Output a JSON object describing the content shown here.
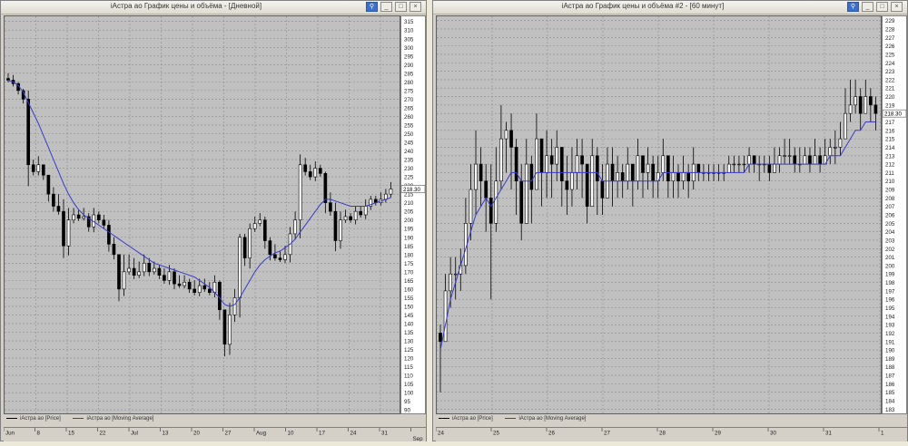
{
  "windows": [
    {
      "title": "iАстра ао График цены и объёма - [Дневной]",
      "buttons": [
        "⚲",
        "_",
        "□",
        "×"
      ],
      "legend": {
        "price": "iАстра ао [Price]",
        "ma": "iАстра ао [Moving Average]"
      },
      "current_price_label": "218.30",
      "x_tick_labels": [
        "Jun",
        "8",
        "15",
        "22",
        "Jul",
        "13",
        "20",
        "27",
        "Aug",
        "10",
        "17",
        "24",
        "31",
        "Sep"
      ],
      "y_tick_labels": [
        "315",
        "310",
        "305",
        "300",
        "295",
        "290",
        "285",
        "280",
        "275",
        "270",
        "265",
        "260",
        "255",
        "250",
        "245",
        "240",
        "235",
        "230",
        "225",
        "220",
        "215",
        "210",
        "205",
        "200",
        "195",
        "190",
        "185",
        "180",
        "175",
        "170",
        "165",
        "160",
        "155",
        "150",
        "145",
        "140",
        "135",
        "130",
        "125",
        "120",
        "115",
        "110",
        "105",
        "100",
        "95",
        "90"
      ]
    },
    {
      "title": "iАстра ао График цены и объёма #2 - [60 минут]",
      "buttons": [
        "⚲",
        "_",
        "□",
        "×"
      ],
      "legend": {
        "price": "iАстра ао [Price]",
        "ma": "iАстра ао [Moving Average]"
      },
      "current_price_label": "218.30",
      "x_tick_labels": [
        "24",
        "25",
        "26",
        "27",
        "28",
        "29",
        "30",
        "31",
        "1",
        "Sep"
      ],
      "y_tick_labels": [
        "229",
        "228",
        "227",
        "226",
        "225",
        "224",
        "223",
        "222",
        "221",
        "220",
        "219",
        "218",
        "217",
        "216",
        "215",
        "214",
        "213",
        "212",
        "211",
        "210",
        "209",
        "208",
        "207",
        "206",
        "205",
        "204",
        "203",
        "202",
        "201",
        "200",
        "199",
        "198",
        "197",
        "196",
        "195",
        "194",
        "193",
        "192",
        "191",
        "190",
        "189",
        "188",
        "187",
        "186",
        "185",
        "184",
        "183"
      ]
    }
  ],
  "chart_data": [
    {
      "type": "candlestick",
      "title": "iАстра ао График цены и объёма - [Дневной]",
      "ylim": [
        88,
        318
      ],
      "grid": true,
      "legend_placement": "bottom-left",
      "series": [
        {
          "name": "iАстра ао [Price]",
          "color": "#000000",
          "close": [
            281,
            279,
            275,
            270,
            232,
            228,
            232,
            226,
            215,
            208,
            205,
            185,
            200,
            203,
            201,
            202,
            196,
            203,
            200,
            197,
            186,
            180,
            160,
            170,
            172,
            168,
            170,
            175,
            170,
            172,
            168,
            165,
            170,
            163,
            162,
            164,
            160,
            158,
            162,
            160,
            158,
            164,
            148,
            128,
            145,
            155,
            190,
            178,
            195,
            198,
            200,
            188,
            180,
            178,
            177,
            180,
            192,
            200,
            232,
            228,
            225,
            230,
            227,
            210,
            205,
            188,
            200,
            202,
            200,
            205,
            203,
            208,
            212,
            210,
            212,
            215,
            218
          ],
          "high": [
            285,
            284,
            280,
            276,
            275,
            235,
            237,
            232,
            226,
            219,
            215,
            212,
            207,
            207,
            206,
            207,
            204,
            207,
            205,
            203,
            200,
            190,
            180,
            180,
            180,
            178,
            176,
            180,
            178,
            176,
            174,
            172,
            174,
            172,
            168,
            168,
            166,
            165,
            166,
            166,
            164,
            168,
            165,
            148,
            152,
            160,
            192,
            192,
            198,
            202,
            204,
            202,
            190,
            186,
            182,
            185,
            196,
            205,
            238,
            236,
            232,
            234,
            232,
            228,
            216,
            210,
            205,
            206,
            204,
            208,
            208,
            212,
            214,
            214,
            216,
            218,
            222
          ]
        },
        {
          "name": "iАстра ао [Moving Average]",
          "color": "#3a3acc",
          "values": [
            281,
            280,
            278,
            274,
            268,
            262,
            256,
            249,
            242,
            235,
            228,
            221,
            215,
            210,
            206,
            203,
            201,
            199,
            197,
            195,
            193,
            191,
            189,
            187,
            185,
            183,
            181,
            179,
            177,
            175,
            174,
            173,
            172,
            171,
            170,
            169,
            168,
            167,
            165,
            163,
            161,
            158,
            155,
            151,
            150,
            151,
            155,
            160,
            165,
            170,
            174,
            177,
            179,
            181,
            182,
            184,
            186,
            189,
            193,
            197,
            201,
            205,
            209,
            212,
            212,
            211,
            210,
            209,
            208,
            208,
            208,
            208,
            209,
            210,
            211,
            212,
            213
          ]
        }
      ]
    },
    {
      "type": "candlestick",
      "title": "iАстра ао График цены и объёма #2 - [60 минут]",
      "ylim": [
        182.5,
        229.5
      ],
      "grid": true,
      "legend_placement": "bottom-left",
      "series": [
        {
          "name": "iАстра ао [Price]",
          "color": "#000000",
          "close": [
            191,
            197,
            199,
            199,
            200,
            205,
            209,
            212,
            210,
            208,
            205,
            210,
            215,
            216,
            214,
            210,
            205,
            212,
            209,
            215,
            211,
            213,
            212,
            214,
            210,
            209,
            211,
            213,
            212,
            207,
            213,
            210,
            208,
            212,
            210,
            211,
            210,
            212,
            210,
            213,
            211,
            212,
            210,
            211,
            213,
            210,
            211,
            210,
            211,
            210,
            212,
            211,
            211,
            211,
            211,
            211,
            211,
            212,
            212,
            212,
            212,
            213,
            212,
            212,
            212,
            211,
            212,
            213,
            213,
            213,
            212,
            212,
            213,
            212,
            213,
            212,
            213,
            214,
            214,
            215,
            218,
            219,
            220,
            218,
            220,
            219,
            218
          ],
          "high": [
            193,
            199,
            201,
            201,
            202,
            208,
            212,
            216,
            214,
            212,
            212,
            214,
            219,
            217,
            218,
            215,
            212,
            215,
            213,
            218,
            215,
            216,
            215,
            216,
            214,
            213,
            214,
            215,
            215,
            212,
            215,
            214,
            212,
            214,
            214,
            213,
            212,
            214,
            212,
            215,
            213,
            214,
            213,
            213,
            215,
            213,
            213,
            212,
            213,
            212,
            214,
            212,
            212,
            212,
            212,
            212,
            212,
            213,
            213,
            213,
            213,
            214,
            213,
            213,
            213,
            213,
            214,
            214,
            215,
            215,
            214,
            214,
            214,
            214,
            215,
            214,
            215,
            215,
            216,
            217,
            221,
            222,
            222,
            221,
            222,
            221,
            220
          ],
          "low": [
            185,
            191,
            195,
            196,
            197,
            199,
            203,
            206,
            207,
            204,
            196,
            204,
            209,
            211,
            209,
            206,
            203,
            206,
            205,
            209,
            207,
            208,
            208,
            210,
            207,
            206,
            207,
            209,
            208,
            205,
            209,
            206,
            206,
            208,
            207,
            208,
            208,
            209,
            207,
            209,
            208,
            209,
            208,
            208,
            210,
            208,
            208,
            208,
            209,
            208,
            209,
            210,
            210,
            210,
            210,
            210,
            210,
            211,
            211,
            211,
            211,
            211,
            211,
            210,
            211,
            210,
            211,
            211,
            212,
            212,
            211,
            211,
            212,
            211,
            212,
            211,
            212,
            212,
            212,
            213,
            216,
            217,
            218,
            216,
            218,
            217,
            216
          ]
        },
        {
          "name": "iАстра ао [Moving Average]",
          "color": "#3a3acc",
          "values": [
            190,
            193,
            196,
            198,
            200,
            202,
            204,
            206,
            207,
            208,
            207,
            208,
            209,
            210,
            211,
            211,
            210,
            210,
            210,
            211,
            211,
            211,
            211,
            211,
            211,
            211,
            211,
            211,
            211,
            211,
            211,
            211,
            210,
            210,
            210,
            210,
            210,
            210,
            210,
            210,
            210,
            210,
            210,
            210,
            211,
            211,
            211,
            211,
            211,
            211,
            211,
            211,
            211,
            211,
            211,
            211,
            211,
            211,
            211,
            211,
            211,
            212,
            212,
            212,
            212,
            212,
            212,
            212,
            212,
            212,
            212,
            212,
            212,
            212,
            212,
            212,
            212,
            213,
            213,
            213,
            214,
            215,
            216,
            216,
            217,
            217,
            217
          ]
        }
      ]
    }
  ]
}
